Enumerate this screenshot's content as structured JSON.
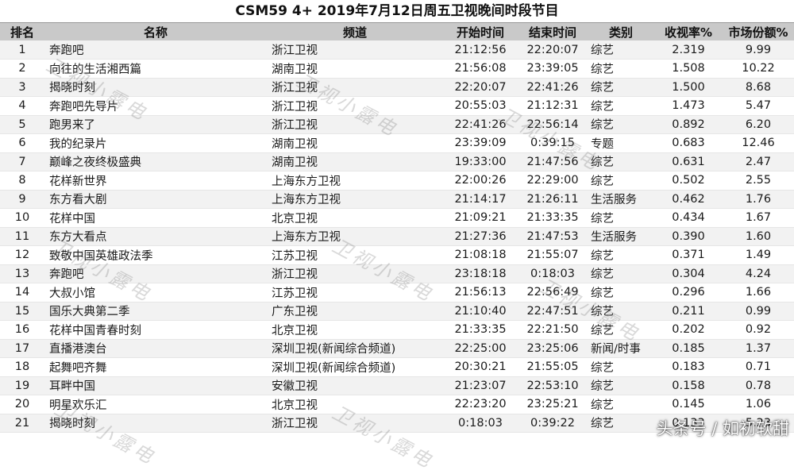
{
  "title": "CSM59 4+ 2019年7月12日周五卫视晚间时段节目",
  "headers": {
    "rank": "排名",
    "name": "名称",
    "channel": "频道",
    "start": "开始时间",
    "end": "结束时间",
    "type": "类别",
    "rating": "收视率%",
    "share": "市场份额%"
  },
  "rows": [
    {
      "rank": "1",
      "name": "奔跑吧",
      "channel": "浙江卫视",
      "start": "21:12:56",
      "end": "22:20:07",
      "type": "综艺",
      "rating": "2.319",
      "share": "9.99"
    },
    {
      "rank": "2",
      "name": "向往的生活湘西篇",
      "channel": "湖南卫视",
      "start": "21:56:08",
      "end": "23:39:05",
      "type": "综艺",
      "rating": "1.508",
      "share": "10.22"
    },
    {
      "rank": "3",
      "name": "揭晓时刻",
      "channel": "浙江卫视",
      "start": "22:20:07",
      "end": "22:41:26",
      "type": "综艺",
      "rating": "1.500",
      "share": "8.68"
    },
    {
      "rank": "4",
      "name": "奔跑吧先导片",
      "channel": "浙江卫视",
      "start": "20:55:03",
      "end": "21:12:31",
      "type": "综艺",
      "rating": "1.473",
      "share": "5.47"
    },
    {
      "rank": "5",
      "name": "跑男来了",
      "channel": "浙江卫视",
      "start": "22:41:26",
      "end": "22:56:14",
      "type": "综艺",
      "rating": "0.892",
      "share": "6.20"
    },
    {
      "rank": "6",
      "name": "我的纪录片",
      "channel": "湖南卫视",
      "start": "23:39:09",
      "end": "0:39:15",
      "type": "专题",
      "rating": "0.683",
      "share": "12.46"
    },
    {
      "rank": "7",
      "name": "巅峰之夜终极盛典",
      "channel": "湖南卫视",
      "start": "19:33:00",
      "end": "21:47:56",
      "type": "综艺",
      "rating": "0.631",
      "share": "2.47"
    },
    {
      "rank": "8",
      "name": "花样新世界",
      "channel": "上海东方卫视",
      "start": "22:00:26",
      "end": "22:29:00",
      "type": "综艺",
      "rating": "0.502",
      "share": "2.55"
    },
    {
      "rank": "9",
      "name": "东方看大剧",
      "channel": "上海东方卫视",
      "start": "21:14:17",
      "end": "21:26:11",
      "type": "生活服务",
      "rating": "0.462",
      "share": "1.76"
    },
    {
      "rank": "10",
      "name": "花样中国",
      "channel": "北京卫视",
      "start": "21:09:21",
      "end": "21:33:35",
      "type": "综艺",
      "rating": "0.434",
      "share": "1.67"
    },
    {
      "rank": "11",
      "name": "东方大看点",
      "channel": "上海东方卫视",
      "start": "21:27:36",
      "end": "21:47:53",
      "type": "生活服务",
      "rating": "0.390",
      "share": "1.60"
    },
    {
      "rank": "12",
      "name": "致敬中国英雄政法季",
      "channel": "江苏卫视",
      "start": "21:08:18",
      "end": "21:55:07",
      "type": "综艺",
      "rating": "0.371",
      "share": "1.49"
    },
    {
      "rank": "13",
      "name": "奔跑吧",
      "channel": "浙江卫视",
      "start": "23:18:18",
      "end": "0:18:03",
      "type": "综艺",
      "rating": "0.304",
      "share": "4.24"
    },
    {
      "rank": "14",
      "name": "大叔小馆",
      "channel": "江苏卫视",
      "start": "21:56:13",
      "end": "22:56:49",
      "type": "综艺",
      "rating": "0.296",
      "share": "1.66"
    },
    {
      "rank": "15",
      "name": "国乐大典第二季",
      "channel": "广东卫视",
      "start": "21:10:40",
      "end": "22:47:51",
      "type": "综艺",
      "rating": "0.211",
      "share": "0.99"
    },
    {
      "rank": "16",
      "name": "花样中国青春时刻",
      "channel": "北京卫视",
      "start": "21:33:35",
      "end": "22:21:50",
      "type": "综艺",
      "rating": "0.202",
      "share": "0.92"
    },
    {
      "rank": "17",
      "name": "直播港澳台",
      "channel": "深圳卫视(新闻综合频道)",
      "start": "22:25:00",
      "end": "23:25:06",
      "type": "新闻/时事",
      "rating": "0.185",
      "share": "1.37"
    },
    {
      "rank": "18",
      "name": "起舞吧齐舞",
      "channel": "深圳卫视(新闻综合频道)",
      "start": "20:30:21",
      "end": "21:55:05",
      "type": "综艺",
      "rating": "0.183",
      "share": "0.71"
    },
    {
      "rank": "19",
      "name": "耳畔中国",
      "channel": "安徽卫视",
      "start": "21:23:07",
      "end": "22:53:10",
      "type": "综艺",
      "rating": "0.158",
      "share": "0.78"
    },
    {
      "rank": "20",
      "name": "明星欢乐汇",
      "channel": "北京卫视",
      "start": "22:23:20",
      "end": "23:25:21",
      "type": "综艺",
      "rating": "0.145",
      "share": "1.06"
    },
    {
      "rank": "21",
      "name": "揭晓时刻",
      "channel": "浙江卫视",
      "start": "0:18:03",
      "end": "0:39:22",
      "type": "综艺",
      "rating": "0.133",
      "share": "5.23"
    }
  ],
  "watermark_text": "卫视小露电",
  "footer_watermark": "头条号 / 如初软甜"
}
